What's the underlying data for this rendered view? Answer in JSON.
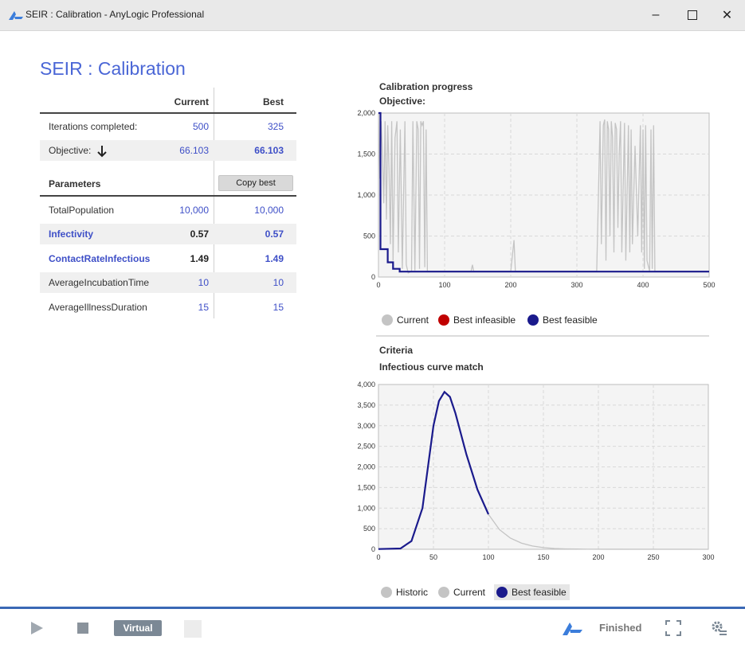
{
  "window": {
    "title": "SEIR : Calibration - AnyLogic Professional"
  },
  "page": {
    "title": "SEIR : Calibration"
  },
  "table": {
    "col_current": "Current",
    "col_best": "Best",
    "iterations": {
      "label": "Iterations completed:",
      "current": "500",
      "best": "325"
    },
    "objective": {
      "label": "Objective:",
      "current": "66.103",
      "best": "66.103",
      "direction_icon": "arrow-down-icon"
    },
    "parameters_header": "Parameters",
    "copy_best_label": "Copy best",
    "params": [
      {
        "name": "TotalPopulation",
        "current": "10,000",
        "best": "10,000"
      },
      {
        "name": "Infectivity",
        "current": "0.57",
        "best": "0.57"
      },
      {
        "name": "ContactRateInfectious",
        "current": "1.49",
        "best": "1.49"
      },
      {
        "name": "AverageIncubationTime",
        "current": "10",
        "best": "10"
      },
      {
        "name": "AverageIllnessDuration",
        "current": "15",
        "best": "15"
      }
    ]
  },
  "progress": {
    "section_title": "Calibration progress",
    "chart_title": "Objective:",
    "legend": [
      "Current",
      "Best infeasible",
      "Best feasible"
    ]
  },
  "criteria": {
    "section_title": "Criteria",
    "chart_title": "Infectious curve match",
    "legend": [
      "Historic",
      "Current",
      "Best feasible"
    ]
  },
  "colors": {
    "current": "#c4c4c4",
    "best_infeasible": "#c00000",
    "best_feasible": "#1a1a8c",
    "historic": "#c4c4c4",
    "accent": "#4a66d6"
  },
  "chart_data": [
    {
      "type": "line",
      "title": "Objective:",
      "xlim": [
        0,
        500
      ],
      "ylim": [
        0,
        2000
      ],
      "x_ticks": [
        "0",
        "100",
        "200",
        "300",
        "400",
        "500"
      ],
      "y_ticks": [
        "0",
        "500",
        "1,000",
        "1,500",
        "2,000"
      ],
      "grid": true,
      "legend_position": "bottom",
      "series": [
        {
          "name": "Current",
          "color": "#c4c4c4",
          "points": [
            [
              0,
              2000
            ],
            [
              2,
              1200
            ],
            [
              4,
              1900
            ],
            [
              6,
              1500
            ],
            [
              8,
              900
            ],
            [
              10,
              1900
            ],
            [
              12,
              700
            ],
            [
              14,
              1850
            ],
            [
              16,
              1300
            ],
            [
              18,
              400
            ],
            [
              20,
              1900
            ],
            [
              22,
              200
            ],
            [
              25,
              1700
            ],
            [
              28,
              1900
            ],
            [
              30,
              300
            ],
            [
              33,
              1800
            ],
            [
              36,
              100
            ],
            [
              40,
              1900
            ],
            [
              42,
              150
            ],
            [
              45,
              50
            ],
            [
              50,
              70
            ],
            [
              52,
              1900
            ],
            [
              55,
              80
            ],
            [
              58,
              1900
            ],
            [
              60,
              1800
            ],
            [
              62,
              100
            ],
            [
              64,
              1900
            ],
            [
              66,
              1850
            ],
            [
              68,
              1900
            ],
            [
              70,
              120
            ],
            [
              72,
              1800
            ],
            [
              74,
              70
            ],
            [
              80,
              70
            ],
            [
              140,
              70
            ],
            [
              142,
              150
            ],
            [
              144,
              70
            ],
            [
              200,
              70
            ],
            [
              203,
              300
            ],
            [
              205,
              450
            ],
            [
              207,
              70
            ],
            [
              330,
              70
            ],
            [
              335,
              1900
            ],
            [
              337,
              400
            ],
            [
              340,
              1850
            ],
            [
              342,
              1920
            ],
            [
              344,
              200
            ],
            [
              346,
              1900
            ],
            [
              348,
              1800
            ],
            [
              350,
              500
            ],
            [
              352,
              1900
            ],
            [
              354,
              1700
            ],
            [
              356,
              300
            ],
            [
              358,
              1880
            ],
            [
              360,
              1800
            ],
            [
              362,
              600
            ],
            [
              364,
              1500
            ],
            [
              366,
              1900
            ],
            [
              368,
              300
            ],
            [
              372,
              1880
            ],
            [
              374,
              200
            ],
            [
              378,
              1850
            ],
            [
              380,
              300
            ],
            [
              382,
              1800
            ],
            [
              384,
              400
            ],
            [
              388,
              1600
            ],
            [
              392,
              500
            ],
            [
              396,
              1850
            ],
            [
              398,
              300
            ],
            [
              400,
              1800
            ],
            [
              402,
              100
            ],
            [
              404,
              1850
            ],
            [
              406,
              200
            ],
            [
              410,
              70
            ],
            [
              412,
              1800
            ],
            [
              414,
              100
            ],
            [
              416,
              1850
            ],
            [
              418,
              70
            ],
            [
              420,
              70
            ],
            [
              500,
              70
            ]
          ]
        },
        {
          "name": "Best infeasible",
          "color": "#c00000",
          "points": []
        },
        {
          "name": "Best feasible",
          "color": "#1a1a8c",
          "points": [
            [
              0,
              2000
            ],
            [
              3,
              2000
            ],
            [
              3,
              340
            ],
            [
              14,
              340
            ],
            [
              14,
              180
            ],
            [
              22,
              180
            ],
            [
              22,
              100
            ],
            [
              32,
              100
            ],
            [
              32,
              66
            ],
            [
              500,
              66
            ]
          ]
        }
      ]
    },
    {
      "type": "line",
      "title": "Infectious curve match",
      "xlim": [
        0,
        300
      ],
      "ylim": [
        0,
        4000
      ],
      "x_ticks": [
        "0",
        "50",
        "100",
        "150",
        "200",
        "250",
        "300"
      ],
      "y_ticks": [
        "0",
        "500",
        "1,000",
        "1,500",
        "2,000",
        "2,500",
        "3,000",
        "3,500",
        "4,000"
      ],
      "grid": true,
      "legend_position": "bottom",
      "series": [
        {
          "name": "Historic",
          "color": "#c4c4c4",
          "points": [
            [
              0,
              5
            ],
            [
              20,
              20
            ],
            [
              30,
              200
            ],
            [
              40,
              1000
            ],
            [
              45,
              2000
            ],
            [
              50,
              3000
            ],
            [
              55,
              3600
            ],
            [
              60,
              3820
            ],
            [
              65,
              3700
            ],
            [
              70,
              3300
            ],
            [
              80,
              2300
            ],
            [
              90,
              1450
            ],
            [
              100,
              850
            ],
            [
              110,
              480
            ],
            [
              120,
              270
            ],
            [
              130,
              150
            ],
            [
              140,
              80
            ],
            [
              150,
              40
            ],
            [
              160,
              20
            ],
            [
              170,
              10
            ],
            [
              180,
              5
            ],
            [
              190,
              2
            ],
            [
              300,
              0
            ]
          ]
        },
        {
          "name": "Current",
          "color": "#c4c4c4",
          "points": []
        },
        {
          "name": "Best feasible",
          "color": "#1a1a8c",
          "points": [
            [
              0,
              5
            ],
            [
              20,
              20
            ],
            [
              30,
              200
            ],
            [
              40,
              1000
            ],
            [
              45,
              2000
            ],
            [
              50,
              3000
            ],
            [
              55,
              3600
            ],
            [
              60,
              3820
            ],
            [
              65,
              3700
            ],
            [
              70,
              3300
            ],
            [
              80,
              2300
            ],
            [
              90,
              1450
            ],
            [
              100,
              850
            ]
          ]
        }
      ]
    }
  ],
  "bottom": {
    "mode_label": "Virtual",
    "status": "Finished"
  }
}
